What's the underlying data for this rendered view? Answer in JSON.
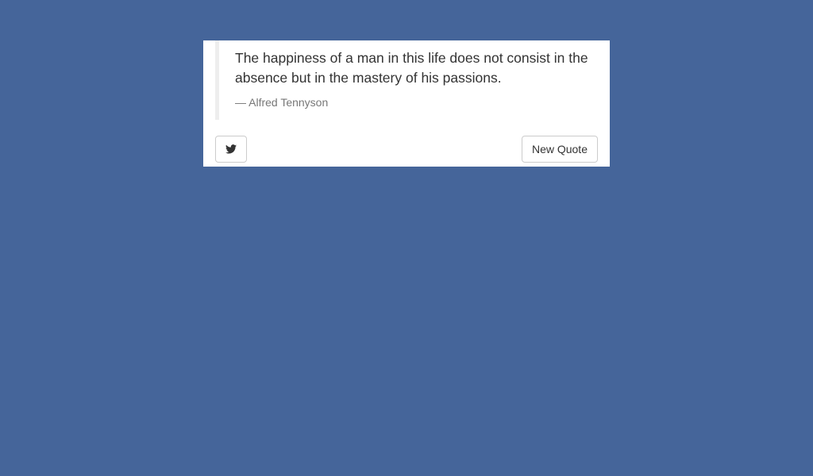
{
  "quote": {
    "text": "The happiness of a man in this life does not consist in the absence but in the mastery of his passions.",
    "author": "— Alfred Tennyson"
  },
  "actions": {
    "tweet_icon": "twitter-bird-icon",
    "new_quote_label": "New Quote"
  },
  "colors": {
    "background": "#45659a",
    "card": "#ffffff",
    "quote_border": "#eeeeee",
    "text": "#333333",
    "author": "#777777"
  }
}
